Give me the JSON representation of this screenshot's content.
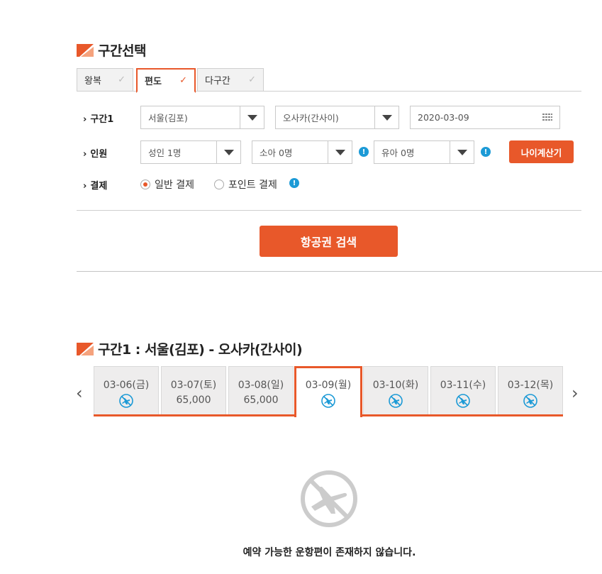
{
  "section1": {
    "title": "구간선택"
  },
  "trip_tabs": [
    {
      "label": "왕복",
      "active": false
    },
    {
      "label": "편도",
      "active": true
    },
    {
      "label": "다구간",
      "active": false
    }
  ],
  "rows": {
    "segment": {
      "label": "구간1",
      "origin": "서울(김포)",
      "destination": "오사카(간사이)",
      "date": "2020-03-09"
    },
    "passengers": {
      "label": "인원",
      "adult": "성인 1명",
      "child": "소아 0명",
      "infant": "유아 0명",
      "age_calc_button": "나이계산기"
    },
    "payment": {
      "label": "결제",
      "options": [
        {
          "label": "일반 결제",
          "selected": true
        },
        {
          "label": "포인트 결제",
          "selected": false
        }
      ]
    }
  },
  "search_button": "항공권 검색",
  "section2": {
    "title": "구간1 :  서울(김포) - 오사카(간사이)"
  },
  "dates": [
    {
      "date": "03-06(금)",
      "price": null
    },
    {
      "date": "03-07(토)",
      "price": "65,000"
    },
    {
      "date": "03-08(일)",
      "price": "65,000"
    },
    {
      "date": "03-09(월)",
      "price": null,
      "active": true
    },
    {
      "date": "03-10(화)",
      "price": null
    },
    {
      "date": "03-11(수)",
      "price": null
    },
    {
      "date": "03-12(목)",
      "price": null
    }
  ],
  "empty_message": "예약 가능한 운항편이 존재하지 않습니다.",
  "colors": {
    "accent": "#e8582a",
    "info": "#1c9ad6"
  }
}
